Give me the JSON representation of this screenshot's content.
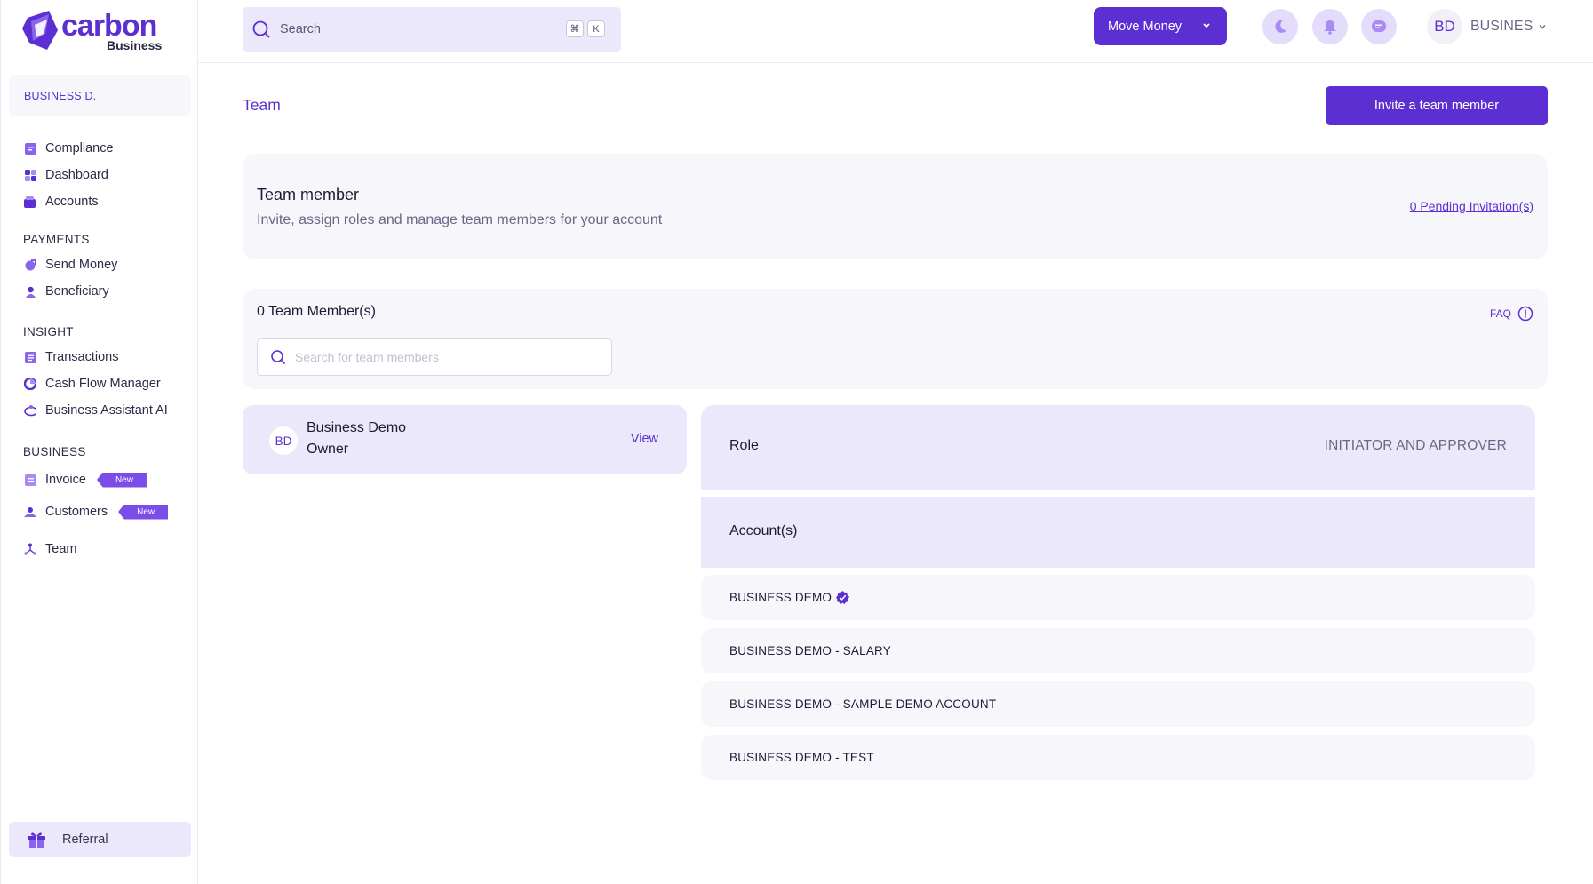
{
  "brand": {
    "name": "carbon",
    "sub": "Business",
    "accent": "#5b2fd1"
  },
  "sidebar": {
    "business_name": "BUSINESS D.",
    "items_top": [
      {
        "label": "Compliance",
        "icon": "compliance-icon"
      },
      {
        "label": "Dashboard",
        "icon": "dashboard-icon"
      },
      {
        "label": "Accounts",
        "icon": "accounts-icon"
      }
    ],
    "sections": {
      "payments": "PAYMENTS",
      "insight": "INSIGHT",
      "business": "BUSINESS"
    },
    "payments_items": [
      {
        "label": "Send Money",
        "icon": "send-money-icon"
      },
      {
        "label": "Beneficiary",
        "icon": "beneficiary-icon"
      }
    ],
    "insight_items": [
      {
        "label": "Transactions",
        "icon": "transactions-icon"
      },
      {
        "label": "Cash Flow Manager",
        "icon": "cash-flow-icon"
      },
      {
        "label": "Business Assistant AI",
        "icon": "assistant-ai-icon"
      }
    ],
    "business_items": [
      {
        "label": "Invoice",
        "icon": "invoice-icon",
        "badge": "New"
      },
      {
        "label": "Customers",
        "icon": "customers-icon",
        "badge": "New"
      },
      {
        "label": "Team",
        "icon": "team-icon"
      }
    ],
    "referral": "Referral"
  },
  "header": {
    "search_placeholder": "Search",
    "shortcut_keys": [
      "⌘",
      "K"
    ],
    "move_money": "Move Money",
    "profile_initials": "BD",
    "profile_name": "BUSINESS DEMO"
  },
  "main": {
    "title": "Team",
    "invite_button": "Invite a team member",
    "team_card": {
      "heading": "Team member",
      "subtitle": "Invite, assign roles and manage team members for your account",
      "pending_link": "0 Pending Invitation(s)"
    },
    "list_card": {
      "count": "0 Team Member(s)",
      "faq": "FAQ",
      "search_placeholder": "Search for team members"
    },
    "member": {
      "initials": "BD",
      "name": "Business Demo",
      "role": "Owner",
      "view": "View"
    },
    "details": {
      "role_label": "Role",
      "role_value": "INITIATOR AND APPROVER",
      "accounts_label": "Account(s)",
      "accounts": [
        {
          "name": "BUSINESS DEMO",
          "verified": true
        },
        {
          "name": "BUSINESS DEMO - SALARY",
          "verified": false
        },
        {
          "name": "BUSINESS DEMO - SAMPLE DEMO ACCOUNT",
          "verified": false
        },
        {
          "name": "BUSINESS DEMO - TEST",
          "verified": false
        }
      ]
    }
  }
}
